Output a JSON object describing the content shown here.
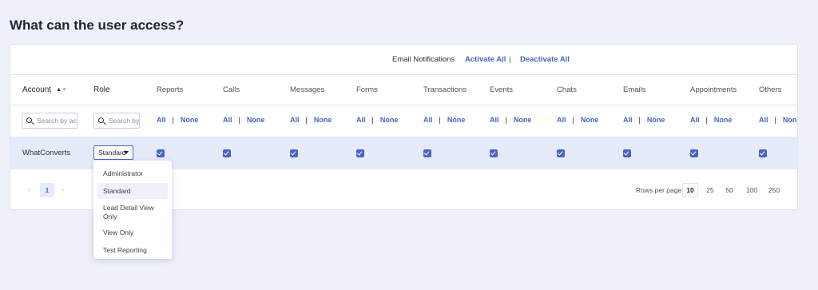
{
  "page_title": "What can the user access?",
  "email_notifications": {
    "label": "Email Notifications",
    "activate_all": "Activate All",
    "separator": "|",
    "deactivate_all": "Deactivate All"
  },
  "columns": {
    "account": "Account",
    "role": "Role",
    "reports": "Reports",
    "calls": "Calls",
    "messages": "Messages",
    "forms": "Forms",
    "transactions": "Transactions",
    "events": "Events",
    "chats": "Chats",
    "emails": "Emails",
    "appointments": "Appointments",
    "others": "Others"
  },
  "filters": {
    "account_placeholder": "Search by acc",
    "role_placeholder": "Search by",
    "all_label": "All",
    "pipe": "|",
    "none_label": "None",
    "last_none_label": "Non"
  },
  "row": {
    "account": "WhatConverts",
    "role": "Standard",
    "checked": [
      true,
      true,
      true,
      true,
      true,
      true,
      true,
      true,
      true,
      true
    ]
  },
  "pagination": {
    "prev": "‹",
    "current_page": "1",
    "next": "›",
    "rows_per_page_label": "Rows per page",
    "options": [
      "10",
      "25",
      "50",
      "100",
      "250"
    ],
    "selected": "10"
  },
  "role_dropdown": {
    "options": [
      "Administrator",
      "Standard",
      "Lead Detail View Only",
      "View Only",
      "Test Reporting"
    ],
    "selected": "Standard"
  },
  "icons": [
    "sort-icon",
    "search-icon",
    "caret-down-icon",
    "checkbox-checked-icon",
    "chevron-left-icon",
    "chevron-right-icon"
  ],
  "colors": {
    "accent": "#4a63c6",
    "row_highlight": "#e6ebfa",
    "background": "#eef1f9"
  }
}
